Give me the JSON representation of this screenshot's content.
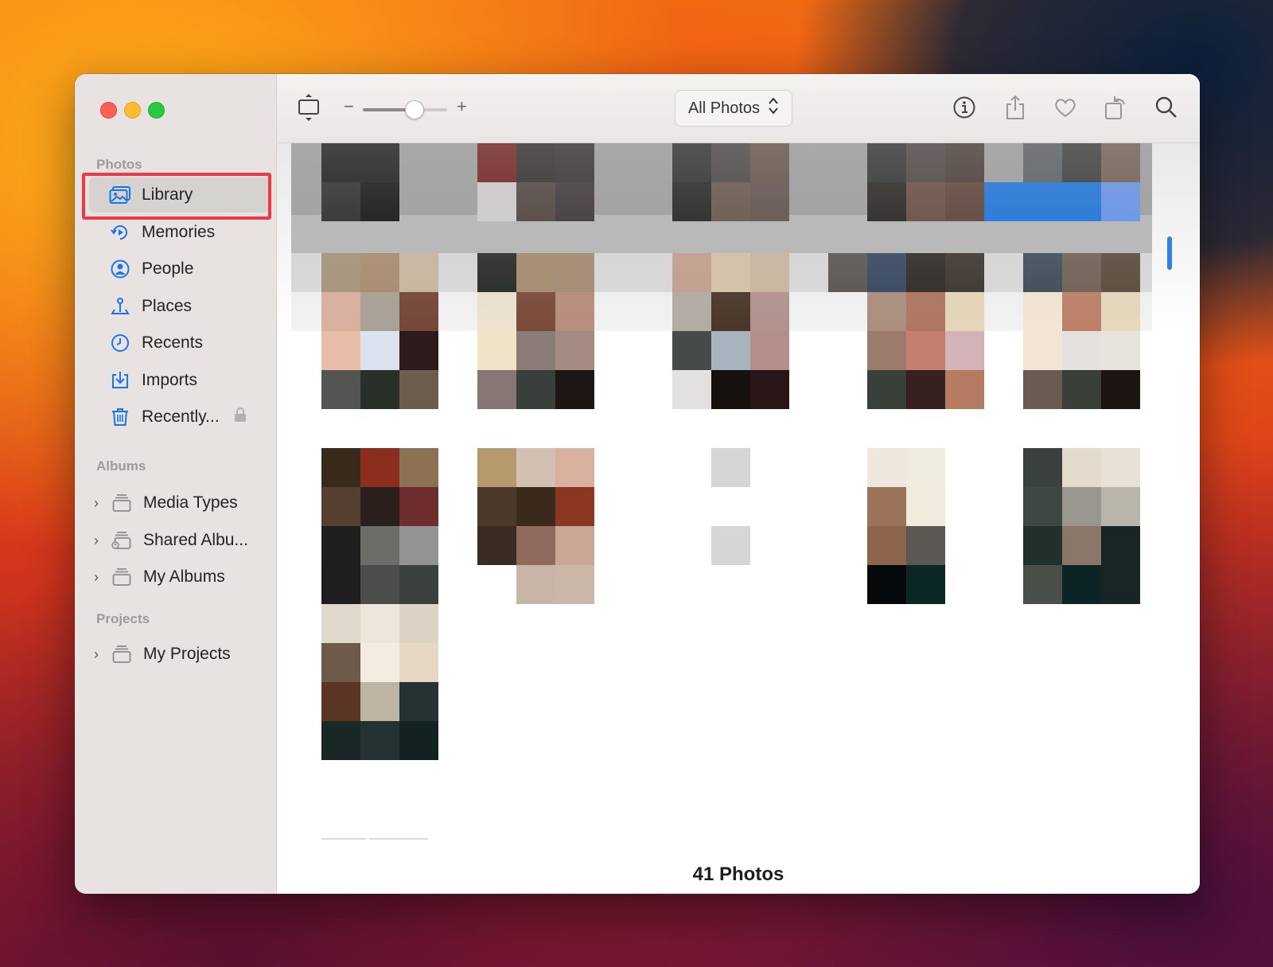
{
  "window": {
    "traffic_lights": [
      "close",
      "minimize",
      "zoom"
    ]
  },
  "sidebar": {
    "sections": {
      "photos": "Photos",
      "albums": "Albums",
      "projects": "Projects"
    },
    "photos_items": [
      {
        "label": "Library",
        "icon": "library-icon",
        "selected": true
      },
      {
        "label": "Memories",
        "icon": "memories-icon"
      },
      {
        "label": "People",
        "icon": "people-icon"
      },
      {
        "label": "Places",
        "icon": "places-icon"
      },
      {
        "label": "Recents",
        "icon": "recents-icon"
      },
      {
        "label": "Imports",
        "icon": "imports-icon"
      },
      {
        "label": "Recently...",
        "icon": "trash-icon",
        "locked": true
      }
    ],
    "album_items": [
      {
        "label": "Media Types",
        "icon": "album-stack-icon"
      },
      {
        "label": "Shared Albu...",
        "icon": "shared-album-icon"
      },
      {
        "label": "My Albums",
        "icon": "album-stack-icon"
      }
    ],
    "project_items": [
      {
        "label": "My Projects",
        "icon": "album-stack-icon"
      }
    ]
  },
  "toolbar": {
    "zoom_minus": "−",
    "zoom_plus": "+",
    "zoom_level": 0.6,
    "view_select": "All Photos",
    "icons": [
      "aspect-ratio-icon",
      "info-icon",
      "share-icon",
      "heart-icon",
      "rotate-icon",
      "search-icon"
    ]
  },
  "colors": {
    "accent": "#1a76e8",
    "highlight_box": "#f2364a"
  },
  "footer": {
    "count": "41 Photos"
  }
}
